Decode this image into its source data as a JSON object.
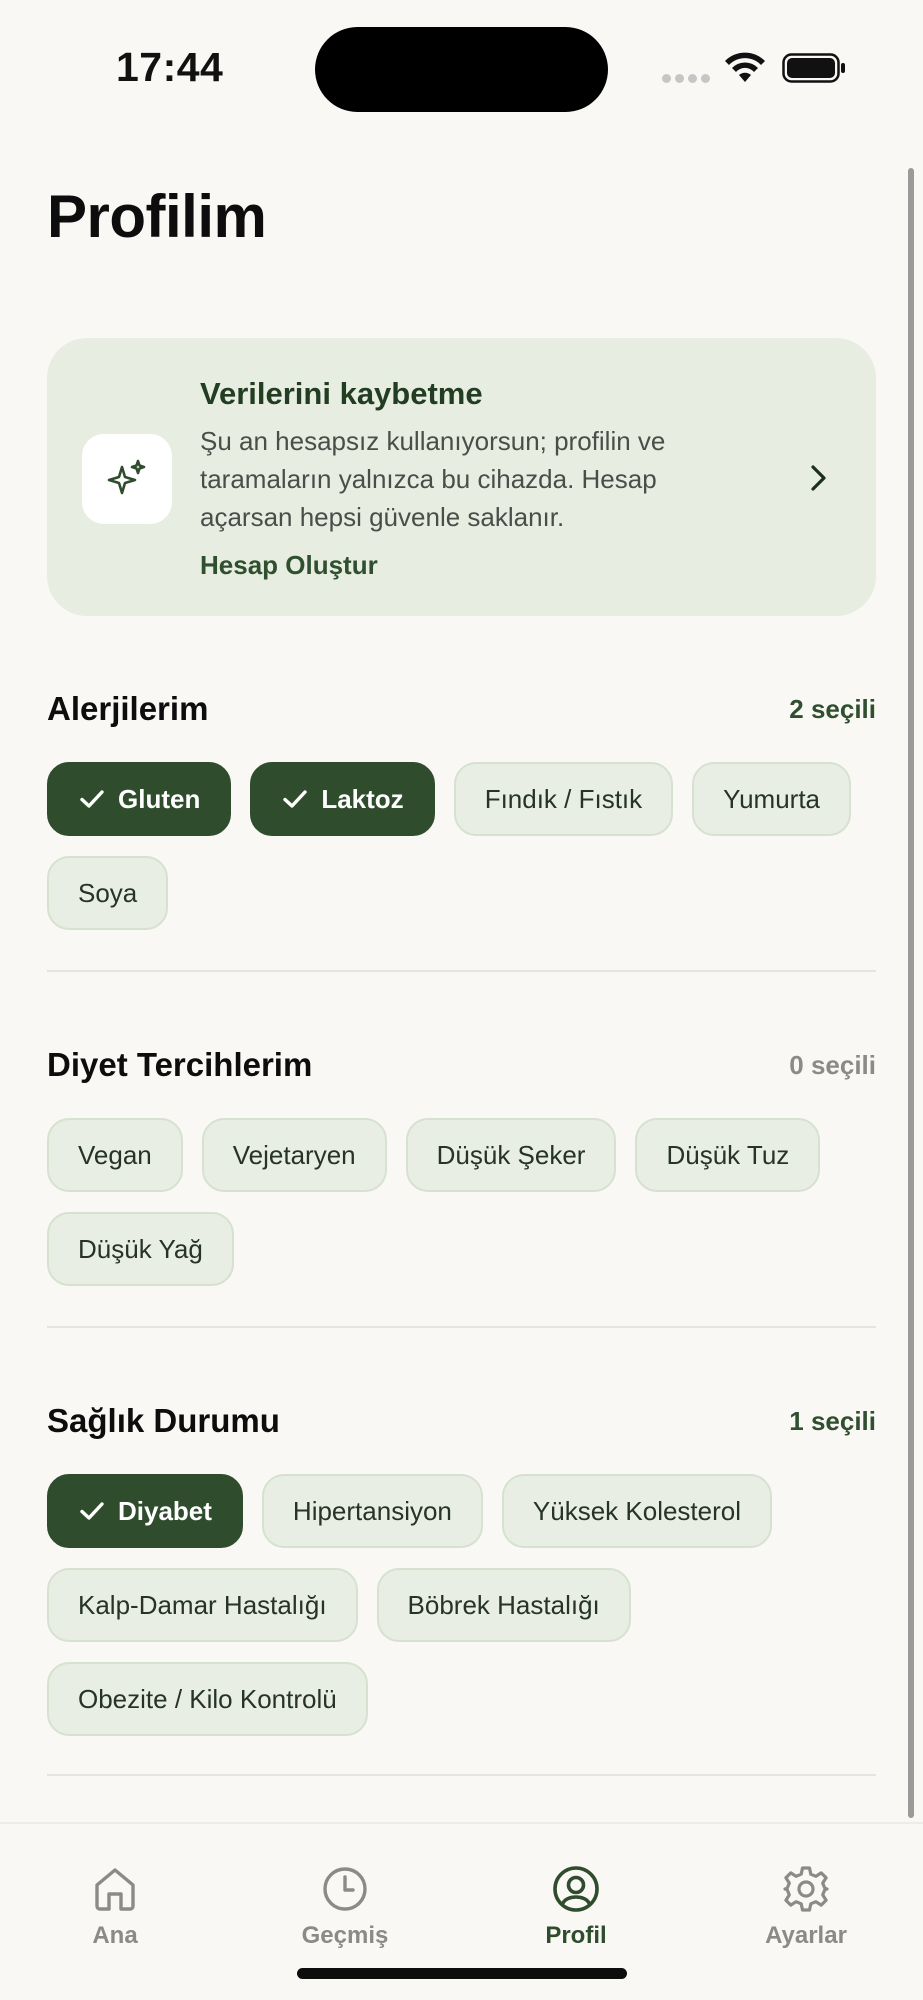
{
  "status_bar": {
    "time": "17:44"
  },
  "page": {
    "title": "Profilim"
  },
  "account_card": {
    "title": "Verilerini kaybetme",
    "text": "Şu an hesapsız kullanıyorsun; profilin ve taramaların yalnızca bu cihazda. Hesap açarsan hepsi güvenle saklanır.",
    "link": "Hesap Oluştur",
    "icon": "sparkles-icon"
  },
  "allergies": {
    "title": "Alerjilerim",
    "count": "2 seçili",
    "chips": [
      {
        "label": "Gluten",
        "selected": true
      },
      {
        "label": "Laktoz",
        "selected": true
      },
      {
        "label": "Fındık / Fıstık",
        "selected": false
      },
      {
        "label": "Yumurta",
        "selected": false
      },
      {
        "label": "Soya",
        "selected": false
      }
    ]
  },
  "diet": {
    "title": "Diyet Tercihlerim",
    "count": "0 seçili",
    "chips": [
      {
        "label": "Vegan",
        "selected": false
      },
      {
        "label": "Vejetaryen",
        "selected": false
      },
      {
        "label": "Düşük Şeker",
        "selected": false
      },
      {
        "label": "Düşük Tuz",
        "selected": false
      },
      {
        "label": "Düşük Yağ",
        "selected": false
      }
    ]
  },
  "health": {
    "title": "Sağlık Durumu",
    "count": "1 seçili",
    "chips": [
      {
        "label": "Diyabet",
        "selected": true
      },
      {
        "label": "Hipertansiyon",
        "selected": false
      },
      {
        "label": "Yüksek Kolesterol",
        "selected": false
      },
      {
        "label": "Kalp-Damar Hastalığı",
        "selected": false
      },
      {
        "label": "Böbrek Hastalığı",
        "selected": false
      },
      {
        "label": "Obezite / Kilo Kontrolü",
        "selected": false
      }
    ]
  },
  "tabbar": {
    "tabs": [
      {
        "label": "Ana",
        "icon": "home-icon",
        "active": false
      },
      {
        "label": "Geçmiş",
        "icon": "clock-icon",
        "active": false
      },
      {
        "label": "Profil",
        "icon": "user-circle-icon",
        "active": true
      },
      {
        "label": "Ayarlar",
        "icon": "gear-icon",
        "active": false
      }
    ]
  },
  "colors": {
    "accent": "#2f4d2d",
    "card_background": "#e7ede1",
    "chip_background": "#e8eee3",
    "page_background": "#f9f8f5"
  }
}
